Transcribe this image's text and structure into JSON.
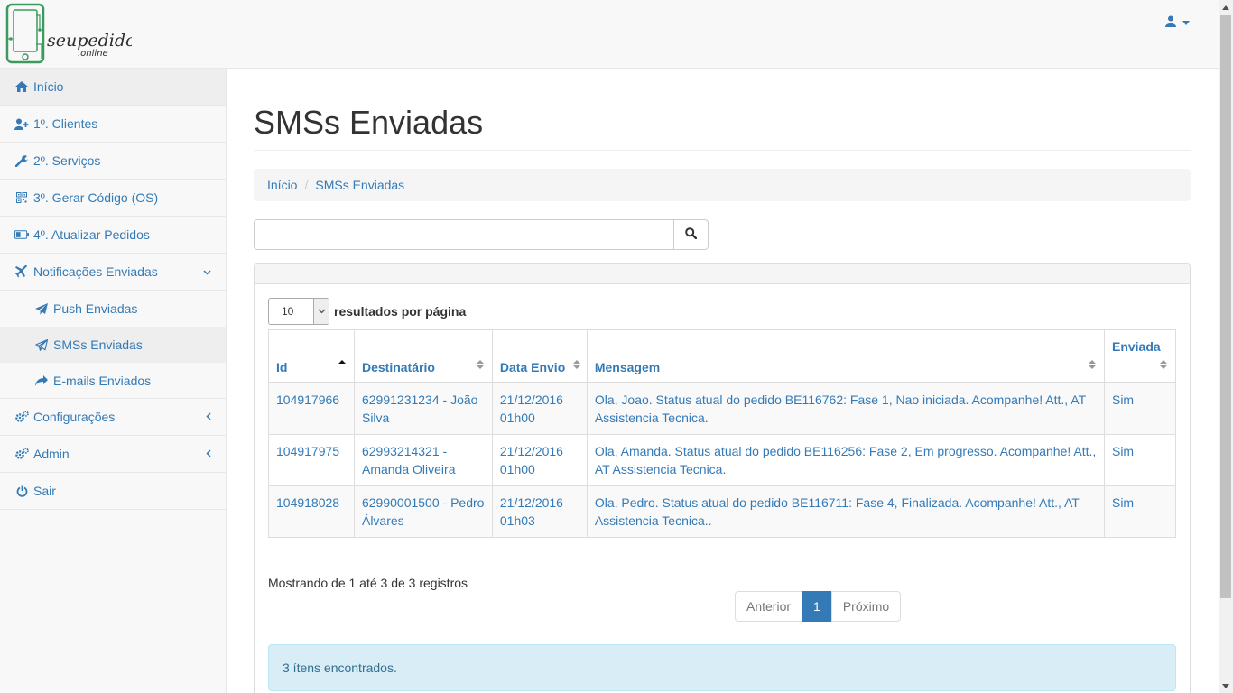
{
  "brand": {
    "logo_text": "seupedido",
    "logo_sub": ".online",
    "color": "#2e8b57"
  },
  "header": {
    "user_icon": "user-icon"
  },
  "sidebar": {
    "items": [
      {
        "label": "Início",
        "icon": "home-icon",
        "active": true
      },
      {
        "label": "1º. Clientes",
        "icon": "user-plus-icon"
      },
      {
        "label": "2º. Serviços",
        "icon": "wrench-icon"
      },
      {
        "label": "3º. Gerar Código (OS)",
        "icon": "qrcode-icon"
      },
      {
        "label": "4º. Atualizar Pedidos",
        "icon": "battery-icon"
      },
      {
        "label": "Notificações Enviadas",
        "icon": "plane-icon",
        "expanded": true
      }
    ],
    "subitems": [
      {
        "label": "Push Enviadas",
        "icon": "send-icon"
      },
      {
        "label": "SMSs Enviadas",
        "icon": "send-outline-icon",
        "active": true
      },
      {
        "label": "E-mails Enviados",
        "icon": "share-icon"
      }
    ],
    "bottom_items": [
      {
        "label": "Configurações",
        "icon": "cogs-icon"
      },
      {
        "label": "Admin",
        "icon": "cogs-icon"
      },
      {
        "label": "Sair",
        "icon": "power-icon"
      }
    ]
  },
  "main": {
    "title": "SMSs Enviadas",
    "breadcrumb": {
      "home": "Início",
      "current": "SMSs Enviadas"
    },
    "search": {
      "value": "",
      "placeholder": ""
    },
    "length": {
      "value": "10",
      "label": "resultados por página"
    },
    "table": {
      "columns": [
        "Id",
        "Destinatário",
        "Data Envio",
        "Mensagem",
        "Enviada"
      ],
      "rows": [
        [
          "104917966",
          "62991231234 - João Silva",
          "21/12/2016 01h00",
          "Ola, Joao. Status atual do pedido BE116762: Fase 1, Nao iniciada. Acompanhe! Att., AT Assistencia Tecnica.",
          "Sim"
        ],
        [
          "104917975",
          "62993214321 - Amanda Oliveira",
          "21/12/2016 01h00",
          "Ola, Amanda. Status atual do pedido BE116256: Fase 2, Em progresso. Acompanhe! Att., AT Assistencia Tecnica.",
          "Sim"
        ],
        [
          "104918028",
          "62990001500 - Pedro Álvares",
          "21/12/2016 01h03",
          "Ola, Pedro. Status atual do pedido BE116711: Fase 4, Finalizada. Acompanhe! Att., AT Assistencia Tecnica..",
          "Sim"
        ]
      ]
    },
    "info": "Mostrando de 1 até 3 de 3 registros",
    "pagination": {
      "prev": "Anterior",
      "current": "1",
      "next": "Próximo"
    },
    "alert": "3 ítens encontrados."
  },
  "colors": {
    "link": "#337ab7",
    "alert_bg": "#d9edf7"
  }
}
